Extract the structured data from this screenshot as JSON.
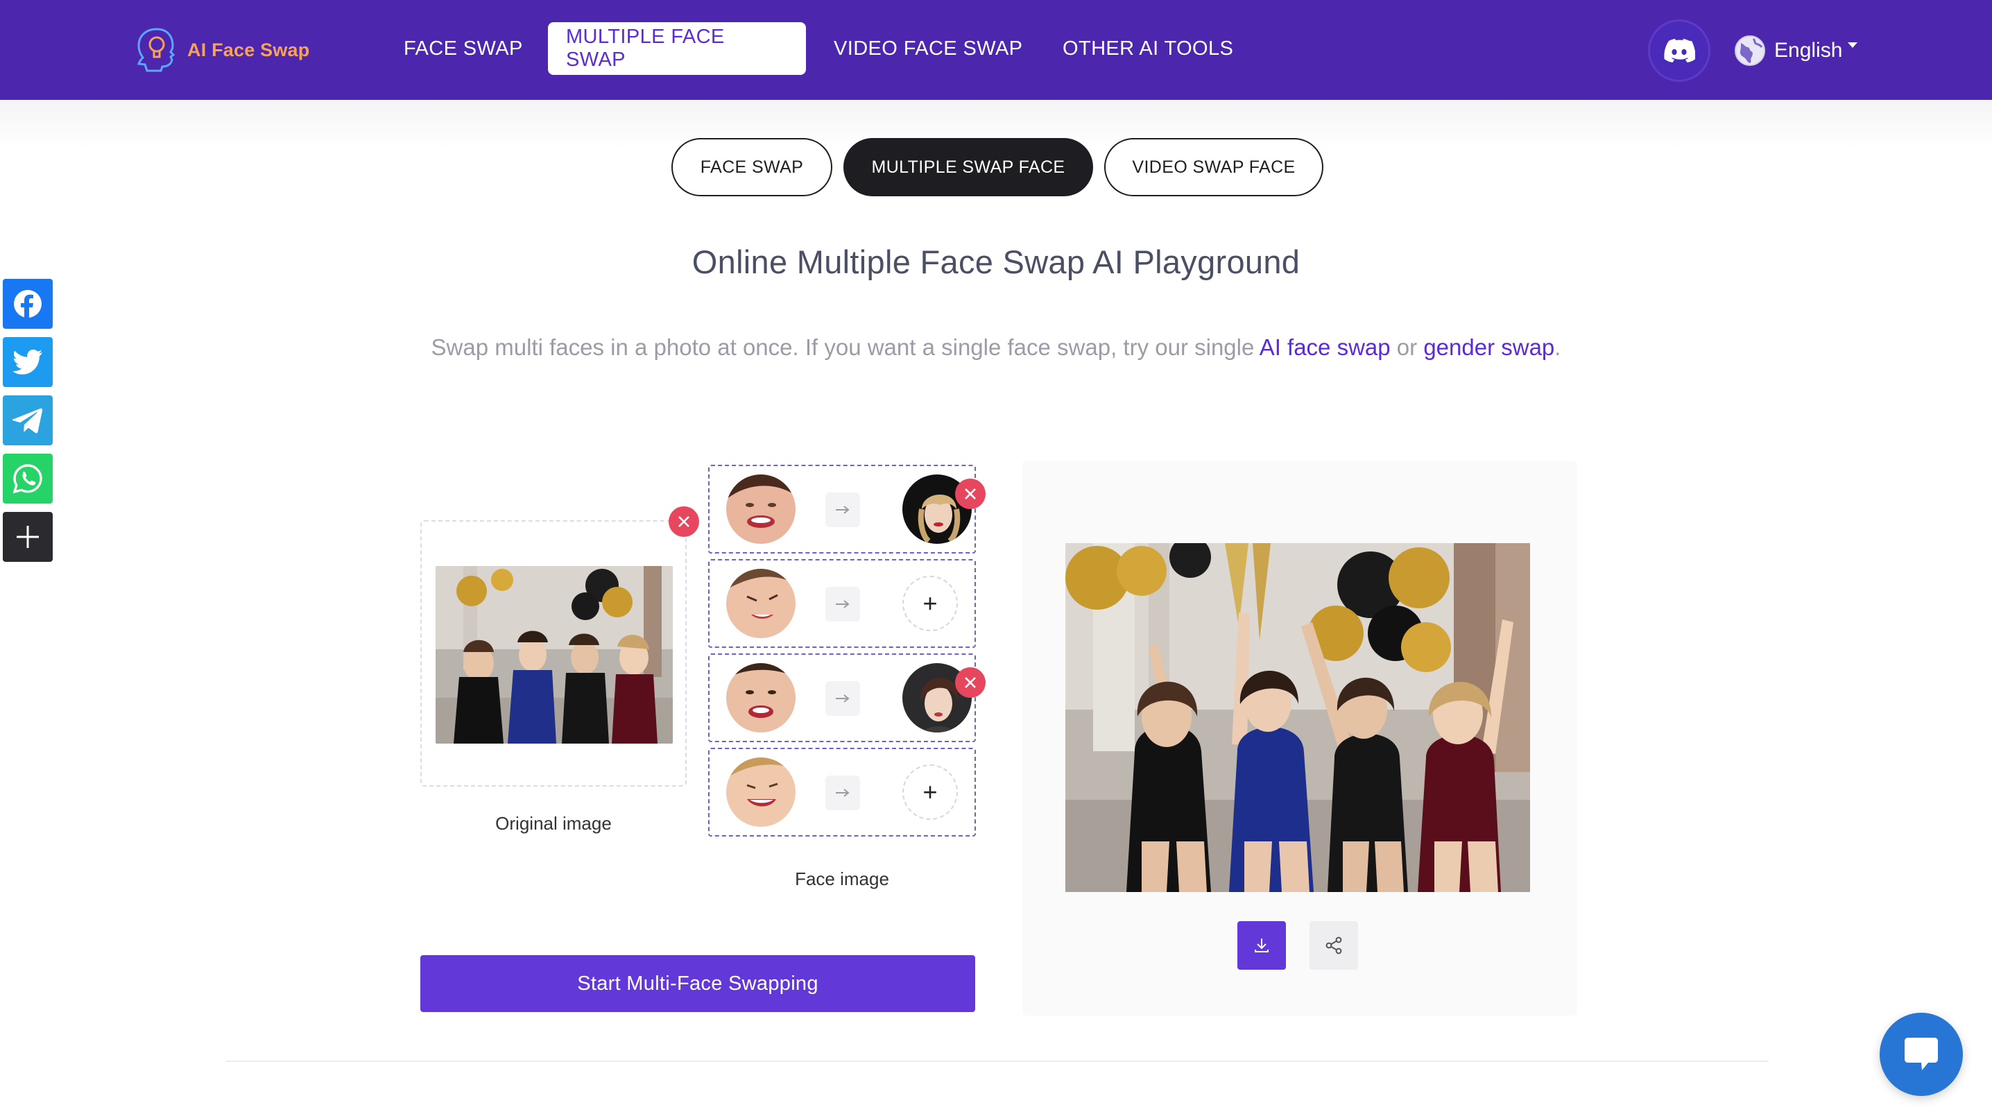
{
  "brand": {
    "name": "AI Face Swap",
    "logo_icon": "head-lightbulb-icon"
  },
  "nav": {
    "items": [
      {
        "label": "FACE SWAP",
        "active": false
      },
      {
        "label": "MULTIPLE FACE SWAP",
        "active": true
      },
      {
        "label": "VIDEO FACE SWAP",
        "active": false
      },
      {
        "label": "OTHER AI TOOLS",
        "active": false
      }
    ],
    "discord_icon": "discord-icon",
    "language": "English"
  },
  "tool_tabs": [
    {
      "label": "FACE SWAP",
      "active": false
    },
    {
      "label": "MULTIPLE SWAP FACE",
      "active": true
    },
    {
      "label": "VIDEO SWAP FACE",
      "active": false
    }
  ],
  "hero": {
    "title": "Online Multiple Face Swap AI Playground",
    "subtitle_prefix": "Swap multi faces in a photo at once. If you want a single face swap, try our single ",
    "link1": "AI face swap",
    "subtitle_mid": " or ",
    "link2": "gender swap",
    "subtitle_suffix": "."
  },
  "social": [
    "facebook-icon",
    "twitter-icon",
    "telegram-icon",
    "whatsapp-icon",
    "plus-icon"
  ],
  "editor": {
    "original_caption": "Original image",
    "face_caption": "Face image",
    "face_rows": [
      {
        "source": "detected-face-1",
        "target": "uploaded-face-1",
        "has_target": true
      },
      {
        "source": "detected-face-2",
        "target": null,
        "has_target": false
      },
      {
        "source": "detected-face-3",
        "target": "uploaded-face-2",
        "has_target": true
      },
      {
        "source": "detected-face-4",
        "target": null,
        "has_target": false
      }
    ],
    "add_symbol": "+",
    "start_button": "Start Multi-Face Swapping"
  },
  "result": {
    "download_icon": "download-icon",
    "share_icon": "share-icon"
  },
  "colors": {
    "header_bg": "#4c26ad",
    "accent": "#6238d8",
    "logo_text": "#f6a25b",
    "remove": "#e7475e",
    "chat": "#2775d4"
  }
}
